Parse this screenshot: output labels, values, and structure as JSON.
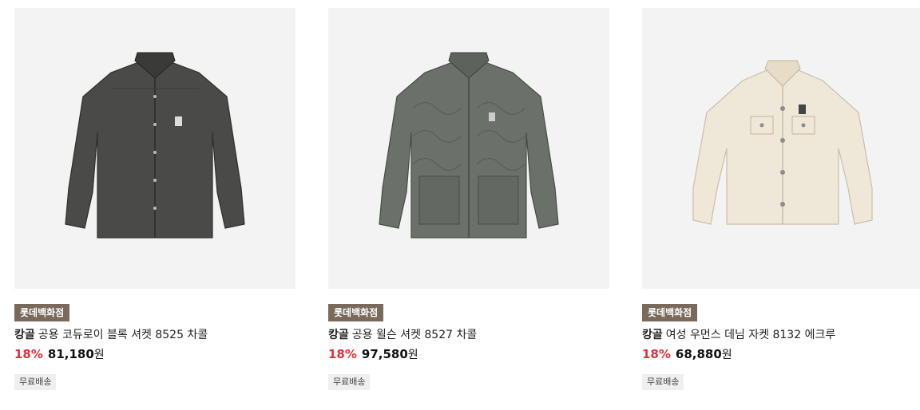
{
  "products": [
    {
      "store": "롯데백화점",
      "brand": "캉골",
      "name": "공용 코듀로이 블록 셔켓 8525 차콜",
      "discount": "18%",
      "price": "81,180",
      "currency": "원",
      "shipping": "무료배송",
      "jacket_color": "#4a4a48",
      "image_icon": "charcoal-shirt-jacket"
    },
    {
      "store": "롯데백화점",
      "brand": "캉골",
      "name": "공용 윌슨 셔켓 8527 차콜",
      "discount": "18%",
      "price": "97,580",
      "currency": "원",
      "shipping": "무료배송",
      "jacket_color": "#6b706a",
      "image_icon": "quilted-shirt-jacket"
    },
    {
      "store": "롯데백화점",
      "brand": "캉골",
      "name": "여성 우먼스 데님 자켓 8132 에크루",
      "discount": "18%",
      "price": "68,880",
      "currency": "원",
      "shipping": "무료배송",
      "jacket_color": "#efe7d8",
      "image_icon": "ecru-denim-jacket"
    }
  ]
}
